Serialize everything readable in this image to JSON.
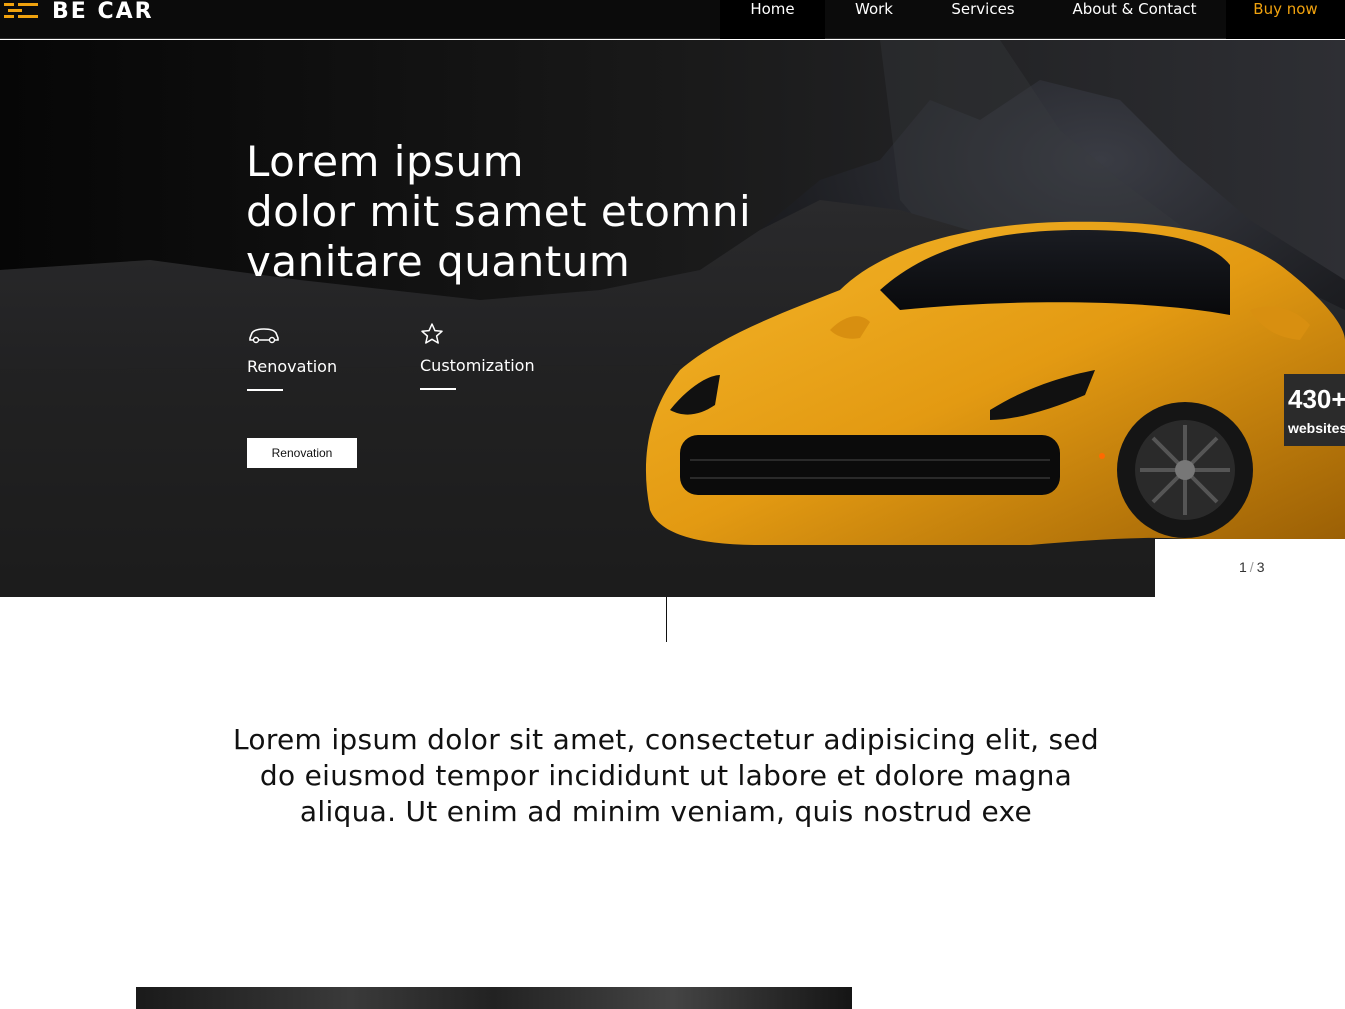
{
  "header": {
    "logo_text": "BE CAR",
    "accent_color": "#f0a20e",
    "nav": [
      {
        "label": "Home",
        "active": true
      },
      {
        "label": "Work"
      },
      {
        "label": "Services"
      },
      {
        "label": "About & Contact"
      },
      {
        "label": "Buy now",
        "accent": true
      }
    ]
  },
  "hero": {
    "title_lines": [
      "Lorem ipsum",
      "dolor mit samet etomni",
      "vanitare quantum"
    ],
    "features": [
      {
        "label": "Renovation",
        "icon": "car-icon"
      },
      {
        "label": "Customization",
        "icon": "star-icon"
      }
    ],
    "button_label": "Renovation",
    "counter": {
      "value": "430+",
      "label": "websites"
    },
    "pager": {
      "current": "1",
      "separator": "/",
      "total": "3"
    }
  },
  "intro": {
    "text": "Lorem ipsum dolor sit amet, consectetur adipisicing elit, sed do eiusmod tempor incididunt ut labore et dolore magna aliqua. Ut enim ad minim veniam, quis nostrud exe"
  }
}
